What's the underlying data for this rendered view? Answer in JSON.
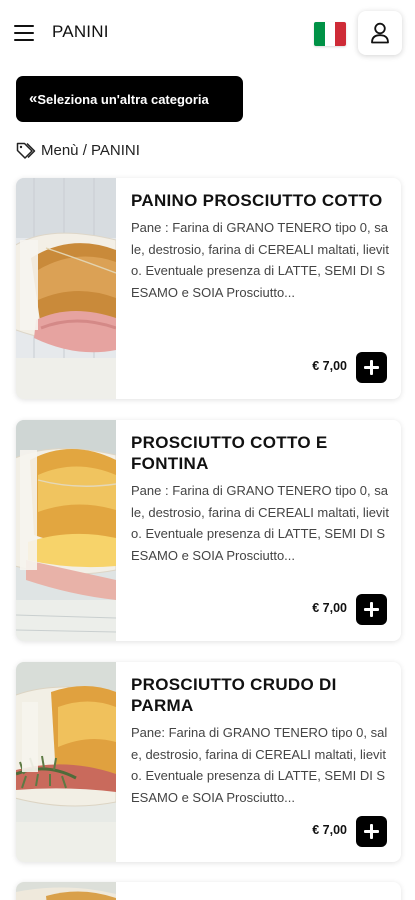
{
  "header": {
    "title": "PANINI",
    "menu_icon": "hamburger-menu-icon",
    "flag_icon": "italian-flag-icon",
    "user_icon": "user-account-icon",
    "flag_colors": [
      "#009246",
      "#ffffff",
      "#ce2b37"
    ]
  },
  "category_button": {
    "label": "Seleziona un'altra categoria",
    "icon": "double-chevron-left-icon"
  },
  "breadcrumb": {
    "icon": "tags-icon",
    "text": "Menù / PANINI"
  },
  "products": [
    {
      "name": "PANINO PROSCIUTTO COTTO",
      "description": "Pane : Farina di GRANO TENERO tipo 0, sale, destrosio, farina di CEREALI maltati, lievito. Eventuale presenza di LATTE, SEMI DI SESAMO e SOIA Prosciutto...",
      "price": "€ 7,00",
      "add_icon": "plus-icon"
    },
    {
      "name": "PROSCIUTTO COTTO E FONTINA",
      "description": "Pane : Farina di GRANO TENERO tipo 0, sale, destrosio, farina di CEREALI maltati, lievito. Eventuale presenza di LATTE, SEMI DI SESAMO e SOIA Prosciutto...",
      "price": "€ 7,00",
      "add_icon": "plus-icon"
    },
    {
      "name": "PROSCIUTTO CRUDO DI PARMA",
      "description": "Pane: Farina di GRANO TENERO tipo 0, sale, destrosio, farina di CEREALI maltati, lievito. Eventuale presenza di LATTE, SEMI DI SESAMO e SOIA Prosciutto...",
      "price": "€ 7,00",
      "add_icon": "plus-icon"
    }
  ],
  "colors": {
    "primary": "#000000",
    "background": "#ffffff",
    "text": "#111111",
    "muted_text": "#444444"
  }
}
